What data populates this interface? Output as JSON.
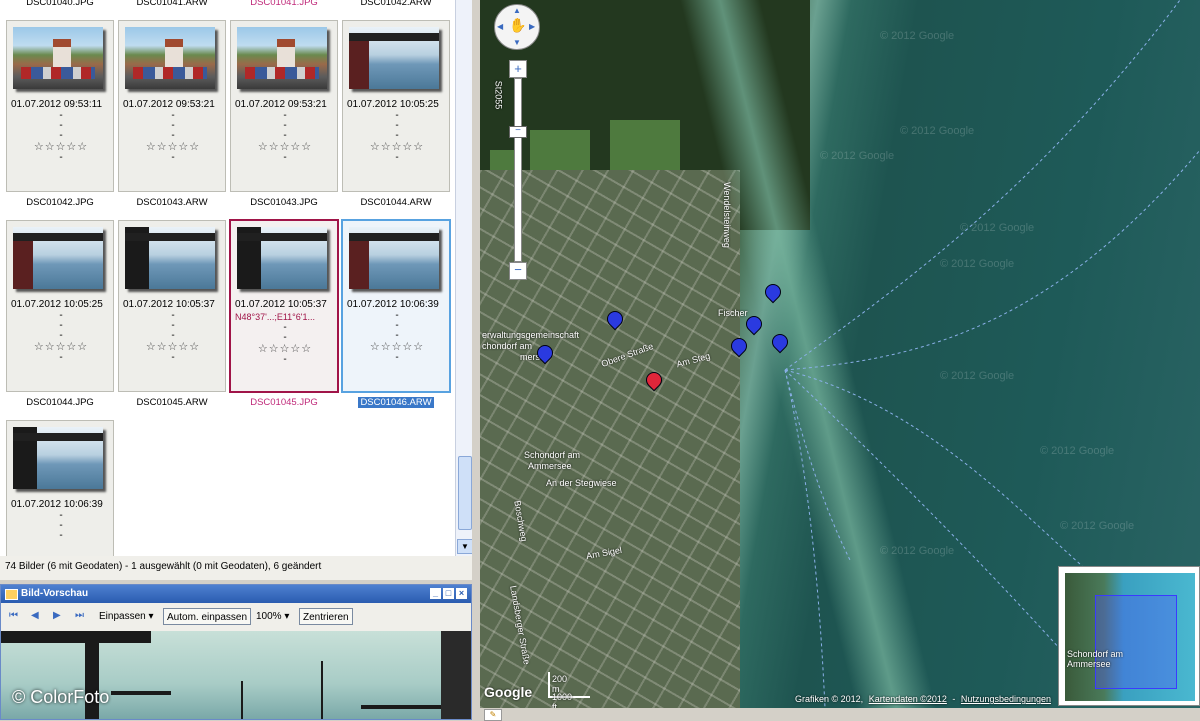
{
  "top_filenames": [
    "DSC01040.JPG",
    "DSC01041.ARW",
    "DSC01041.JPG",
    "DSC01042.ARW"
  ],
  "rows": [
    {
      "cells": [
        {
          "datetime": "01.07.2012 09:53:11",
          "geo": "",
          "stars": "☆☆☆☆☆",
          "filename": "DSC01042.JPG"
        },
        {
          "datetime": "01.07.2012 09:53:21",
          "geo": "",
          "stars": "☆☆☆☆☆",
          "filename": "DSC01043.ARW"
        },
        {
          "datetime": "01.07.2012 09:53:21",
          "geo": "",
          "stars": "☆☆☆☆☆",
          "filename": "DSC01043.JPG"
        },
        {
          "datetime": "01.07.2012 10:05:25",
          "geo": "",
          "stars": "☆☆☆☆☆",
          "filename": "DSC01044.ARW"
        }
      ]
    },
    {
      "cells": [
        {
          "datetime": "01.07.2012 10:05:25",
          "geo": "",
          "stars": "☆☆☆☆☆",
          "filename": "DSC01044.JPG"
        },
        {
          "datetime": "01.07.2012 10:05:37",
          "geo": "",
          "stars": "☆☆☆☆☆",
          "filename": "DSC01045.ARW"
        },
        {
          "datetime": "01.07.2012 10:05:37",
          "geo": "N48°37'...;E11°6'1...",
          "stars": "☆☆☆☆☆",
          "filename": "DSC01045.JPG"
        },
        {
          "datetime": "01.07.2012 10:06:39",
          "geo": "",
          "stars": "☆☆☆☆☆",
          "filename": "DSC01046.ARW"
        }
      ]
    }
  ],
  "last_cell": {
    "datetime": "01.07.2012 10:06:39"
  },
  "dash": "-",
  "status_text": "74 Bilder (6 mit Geodaten) - 1 ausgewählt (0 mit Geodaten), 6 geändert",
  "preview": {
    "title": "Bild-Vorschau",
    "fit_select": "Einpassen",
    "auto_fit": "Autom. einpassen",
    "zoom": "100%",
    "center": "Zentrieren"
  },
  "copyright": "© ColorFoto",
  "map": {
    "labels": {
      "verwaltung": "erwaltungsgemeinschaft",
      "schondorf_am": "chondorf am",
      "mersee": "mersee",
      "schondorf_town": "Schondorf am",
      "ammersee": "Ammersee",
      "wendelstein": "Wendelsteinweg",
      "fischer": "Fischer",
      "obere": "Obere Straße",
      "am_steg": "Am Steg",
      "landsberger": "Landsberger Straße",
      "st2055": "St2055",
      "am_sigel": "Am Sigel",
      "an_der_steg": "An der Stegwiese",
      "boschweg": "Boschweg",
      "am_sigel2": "Am Sigel"
    },
    "watermarks": [
      "© 2012 Google",
      "© 2012 Google",
      "© 2012 Google",
      "© 2012 Google",
      "© 2012 Google",
      "© 2012 Google",
      "© 2012 Google",
      "© 2012 Google",
      "© 2012 Google"
    ],
    "scale_m": "200 m",
    "scale_ft": "1000 ft",
    "google": "Google",
    "attribution": {
      "grafiken": "Grafiken © 2012,",
      "kartendaten": "Kartendaten ©2012",
      "nutzung": "Nutzungsbedingungen"
    },
    "overview_label_1": "Schondorf am",
    "overview_label_2": "Ammersee"
  }
}
